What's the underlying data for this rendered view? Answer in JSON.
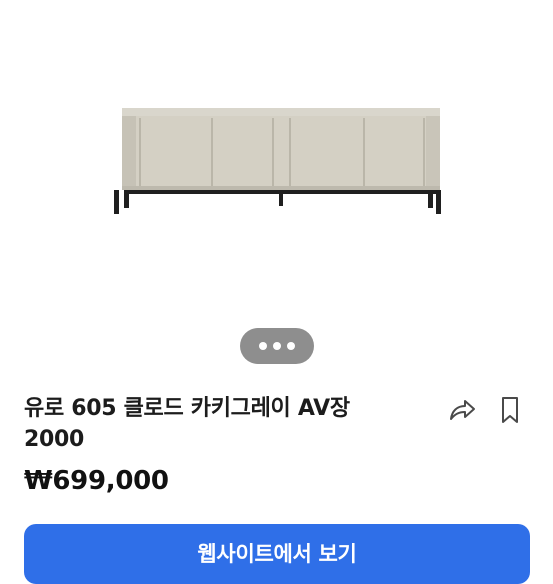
{
  "product": {
    "image_alt": "AV cabinet product photo",
    "title_line1": "유로 605 클로드 카키그레이 AV장",
    "title_line2": "2000",
    "price": "₩699,000"
  },
  "pager": {
    "dots": 3
  },
  "actions": {
    "share_icon": "share-icon",
    "bookmark_icon": "bookmark-icon"
  },
  "cta": {
    "label": "웹사이트에서 보기"
  },
  "colors": {
    "cta_bg": "#2f6fe8",
    "pager_bg": "#8e8e8e",
    "cabinet_body": "#d6d2c7"
  }
}
